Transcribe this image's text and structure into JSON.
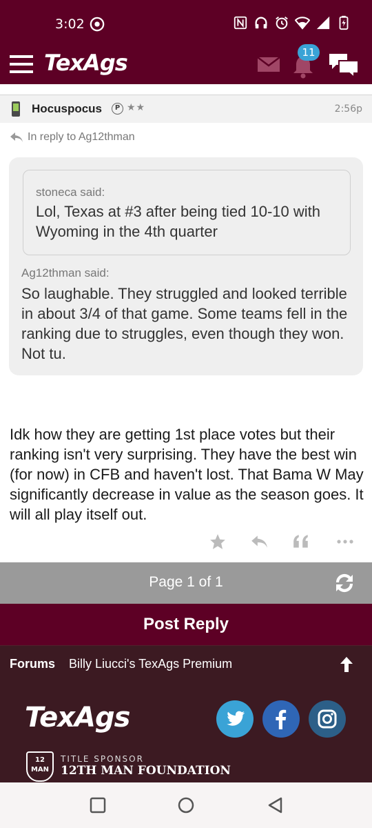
{
  "status_bar": {
    "time": "3:02"
  },
  "app_bar": {
    "logo": "TexAgs",
    "notification_count": "11"
  },
  "post": {
    "username": "Hocuspocus",
    "badge": "P",
    "stars": "★★",
    "time": "2:56p",
    "reply_to": "In reply to Ag12thman",
    "inner_quote": {
      "said": "stoneca said:",
      "text": "Lol, Texas at #3 after being tied 10-10 with Wyoming in the 4th quarter"
    },
    "outer_quote": {
      "said": "Ag12thman said:",
      "text": "So laughable. They struggled and looked terrible in about 3/4 of that game. Some teams fell in the ranking due to struggles, even though they won. Not tu."
    },
    "body": "Idk how they are getting 1st place votes but their ranking isn't very surprising. They have the best win (for now) in CFB and haven't lost. That Bama W May significantly decrease in value as the season goes. It will all play itself out."
  },
  "pager": {
    "text": "Page 1 of 1"
  },
  "post_reply": {
    "label": "Post Reply"
  },
  "forums_bar": {
    "label": "Forums",
    "crumb": "Billy Liucci's TexAgs Premium"
  },
  "footer": {
    "logo": "TexAgs",
    "sponsor_small": "TITLE SPONSOR",
    "sponsor_name": "12TH MAN FOUNDATION",
    "sponsor_badge": "12 MAN"
  },
  "colors": {
    "maroon": "#5d0025",
    "dark_maroon": "#3c1a22",
    "badge_blue": "#3aa3d6",
    "twitter": "#3aa3d6",
    "facebook": "#2f66b6",
    "instagram": "#2c5f88"
  }
}
